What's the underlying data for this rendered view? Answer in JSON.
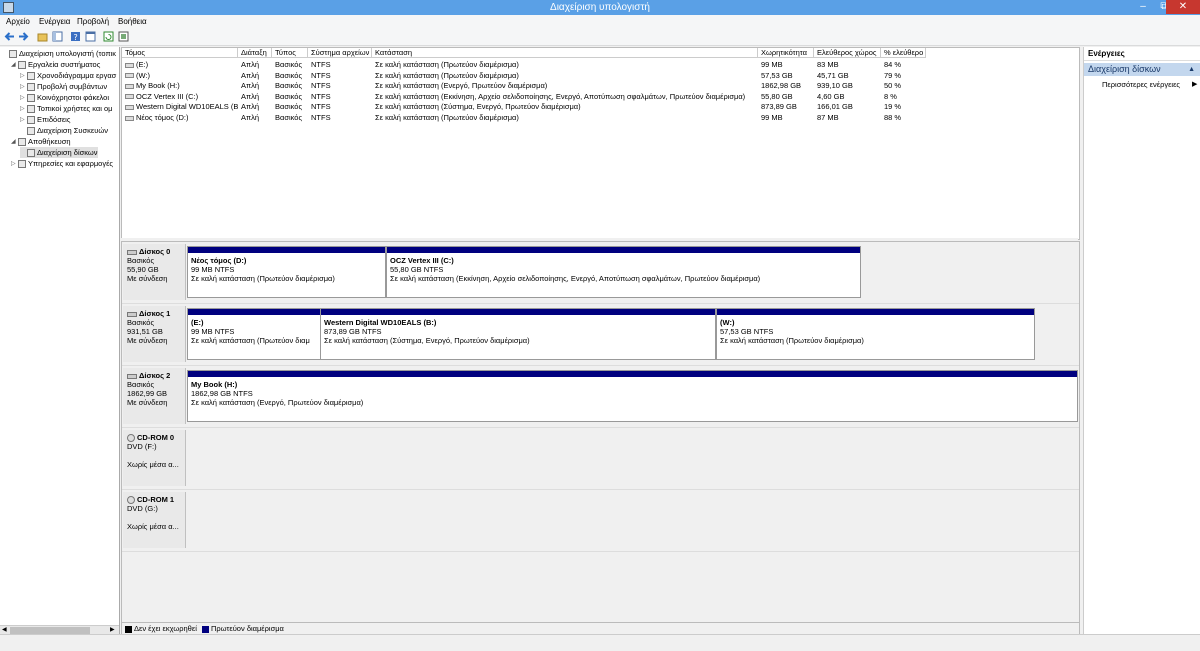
{
  "window": {
    "title": "Διαχείριση υπολογιστή",
    "minimize_glyph": "–",
    "maximize_glyph": "⧉",
    "close_glyph": "✕"
  },
  "menu": [
    "Αρχείο",
    "Ενέργεια",
    "Προβολή",
    "Βοήθεια"
  ],
  "tree": [
    {
      "label": "Διαχείριση υπολογιστή (τοπικ",
      "level": 0,
      "icon": "computer-icon",
      "expander": ""
    },
    {
      "label": "Εργαλεία συστήματος",
      "level": 1,
      "icon": "tools-icon",
      "expander": "◢"
    },
    {
      "label": "Χρονοδιάγραμμα εργασ",
      "level": 2,
      "icon": "clock-icon",
      "expander": "▷"
    },
    {
      "label": "Προβολή συμβάντων",
      "level": 2,
      "icon": "event-viewer-icon",
      "expander": "▷"
    },
    {
      "label": "Κοινόχρηστοι φάκελοι",
      "level": 2,
      "icon": "shared-folder-icon",
      "expander": "▷"
    },
    {
      "label": "Τοπικοί χρήστες και ομ",
      "level": 2,
      "icon": "users-icon",
      "expander": "▷"
    },
    {
      "label": "Επιδόσεις",
      "level": 2,
      "icon": "performance-icon",
      "expander": "▷"
    },
    {
      "label": "Διαχείριση Συσκευών",
      "level": 2,
      "icon": "device-manager-icon",
      "expander": ""
    },
    {
      "label": "Αποθήκευση",
      "level": 1,
      "icon": "storage-icon",
      "expander": "◢"
    },
    {
      "label": "Διαχείριση δίσκων",
      "level": 2,
      "icon": "disk-management-icon",
      "expander": "",
      "selected": true
    },
    {
      "label": "Υπηρεσίες και εφαρμογές",
      "level": 1,
      "icon": "services-icon",
      "expander": "▷"
    }
  ],
  "volumes": {
    "columns": [
      "Τόμος",
      "Διάταξη",
      "Τύπος",
      "Σύστημα αρχείων",
      "Κατάσταση",
      "Χωρητικότητα",
      "Ελεύθερος χώρος",
      "% ελεύθερο"
    ],
    "rows": [
      [
        "(E:)",
        "Απλή",
        "Βασικός",
        "NTFS",
        "Σε καλή κατάσταση (Πρωτεύον διαμέρισμα)",
        "99 MB",
        "83 MB",
        "84 %"
      ],
      [
        "(W:)",
        "Απλή",
        "Βασικός",
        "NTFS",
        "Σε καλή κατάσταση (Πρωτεύον διαμέρισμα)",
        "57,53 GB",
        "45,71 GB",
        "79 %"
      ],
      [
        "My Book (H:)",
        "Απλή",
        "Βασικός",
        "NTFS",
        "Σε καλή κατάσταση (Ενεργό, Πρωτεύον διαμέρισμα)",
        "1862,98 GB",
        "939,10 GB",
        "50 %"
      ],
      [
        "OCZ Vertex III (C:)",
        "Απλή",
        "Βασικός",
        "NTFS",
        "Σε καλή κατάσταση (Εκκίνηση, Αρχείο σελιδοποίησης, Ενεργό, Αποτύπωση σφαλμάτων, Πρωτεύον διαμέρισμα)",
        "55,80 GB",
        "4,60 GB",
        "8 %"
      ],
      [
        "Western Digital WD10EALS (B:)",
        "Απλή",
        "Βασικός",
        "NTFS",
        "Σε καλή κατάσταση (Σύστημα, Ενεργό, Πρωτεύον διαμέρισμα)",
        "873,89 GB",
        "166,01 GB",
        "19 %"
      ],
      [
        "Νέος τόμος (D:)",
        "Απλή",
        "Βασικός",
        "NTFS",
        "Σε καλή κατάσταση (Πρωτεύον διαμέρισμα)",
        "99 MB",
        "87 MB",
        "88 %"
      ]
    ]
  },
  "disks": [
    {
      "name": "Δίσκος 0",
      "type": "Βασικός",
      "size": "55,90 GB",
      "status": "Με σύνδεση",
      "partitions": [
        {
          "name": "Νέος τόμος  (D:)",
          "size": "99 MB NTFS",
          "status": "Σε καλή κατάσταση (Πρωτεύον διαμέρισμα)"
        },
        {
          "name": "OCZ Vertex III  (C:)",
          "size": "55,80 GB NTFS",
          "status": "Σε καλή κατάσταση (Εκκίνηση, Αρχείο σελιδοποίησης, Ενεργό, Αποτύπωση σφαλμάτων, Πρωτεύον διαμέρισμα)"
        }
      ]
    },
    {
      "name": "Δίσκος 1",
      "type": "Βασικός",
      "size": "931,51 GB",
      "status": "Με σύνδεση",
      "partitions": [
        {
          "name": "(E:)",
          "size": "99 MB NTFS",
          "status": "Σε καλή κατάσταση (Πρωτεύον διαμ"
        },
        {
          "name": "Western Digital WD10EALS  (B:)",
          "size": "873,89 GB NTFS",
          "status": "Σε καλή κατάσταση (Σύστημα, Ενεργό, Πρωτεύον διαμέρισμα)"
        },
        {
          "name": "(W:)",
          "size": "57,53 GB NTFS",
          "status": "Σε καλή κατάσταση (Πρωτεύον διαμέρισμα)"
        }
      ]
    },
    {
      "name": "Δίσκος 2",
      "type": "Βασικός",
      "size": "1862,99 GB",
      "status": "Με σύνδεση",
      "partitions": [
        {
          "name": "My Book  (H:)",
          "size": "1862,98 GB NTFS",
          "status": "Σε καλή κατάσταση (Ενεργό, Πρωτεύον διαμέρισμα)"
        }
      ]
    },
    {
      "name": "CD-ROM 0",
      "type": "DVD (F:)",
      "size": "",
      "status": "Χωρίς μέσα α...",
      "partitions": []
    },
    {
      "name": "CD-ROM 1",
      "type": "DVD (G:)",
      "size": "",
      "status": "Χωρίς μέσα α...",
      "partitions": []
    }
  ],
  "legend": {
    "unallocated": "Δεν έχει εκχωρηθεί",
    "primary": "Πρωτεύον διαμέρισμα",
    "unallocated_color": "#000000",
    "primary_color": "#00007f"
  },
  "actions": {
    "header": "Ενέργειες",
    "section": "Διαχείριση δίσκων",
    "section_arrow": "▲",
    "more": "Περισσότερες ενέργειες",
    "more_arrow": "▶"
  },
  "colors": {
    "titlebar": "#5aa0e6",
    "partition_bar": "#00007f",
    "close_button": "#c7372f"
  }
}
